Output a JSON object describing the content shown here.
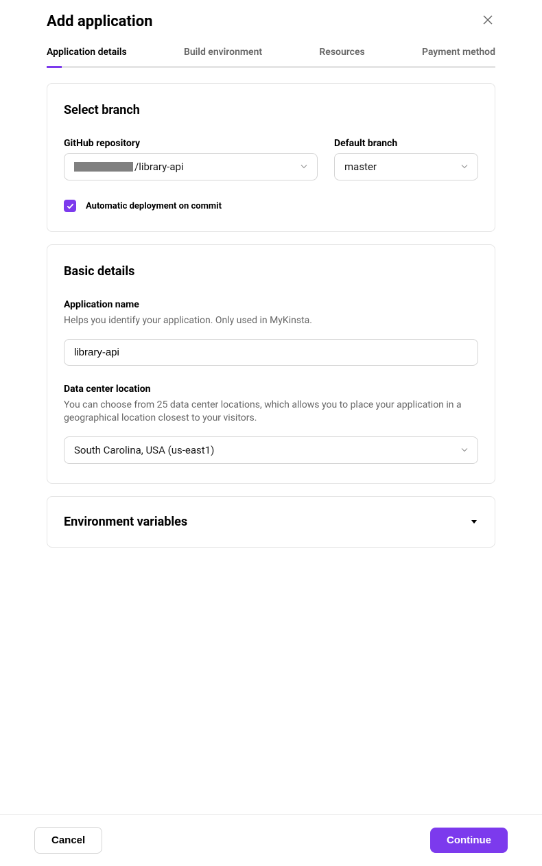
{
  "header": {
    "title": "Add application"
  },
  "tabs": [
    {
      "label": "Application details",
      "active": true
    },
    {
      "label": "Build environment",
      "active": false
    },
    {
      "label": "Resources",
      "active": false
    },
    {
      "label": "Payment method",
      "active": false
    }
  ],
  "select_branch": {
    "title": "Select branch",
    "repo_label": "GitHub repository",
    "repo_value_suffix": "/library-api",
    "branch_label": "Default branch",
    "branch_value": "master",
    "auto_deploy_label": "Automatic deployment on commit",
    "auto_deploy_checked": true
  },
  "basic_details": {
    "title": "Basic details",
    "app_name_label": "Application name",
    "app_name_help": "Helps you identify your application. Only used in MyKinsta.",
    "app_name_value": "library-api",
    "datacenter_label": "Data center location",
    "datacenter_help": "You can choose from 25 data center locations, which allows you to place your application in a geographical location closest to your visitors.",
    "datacenter_value": "South Carolina, USA (us-east1)"
  },
  "env_vars": {
    "title": "Environment variables"
  },
  "footer": {
    "cancel": "Cancel",
    "continue": "Continue"
  }
}
